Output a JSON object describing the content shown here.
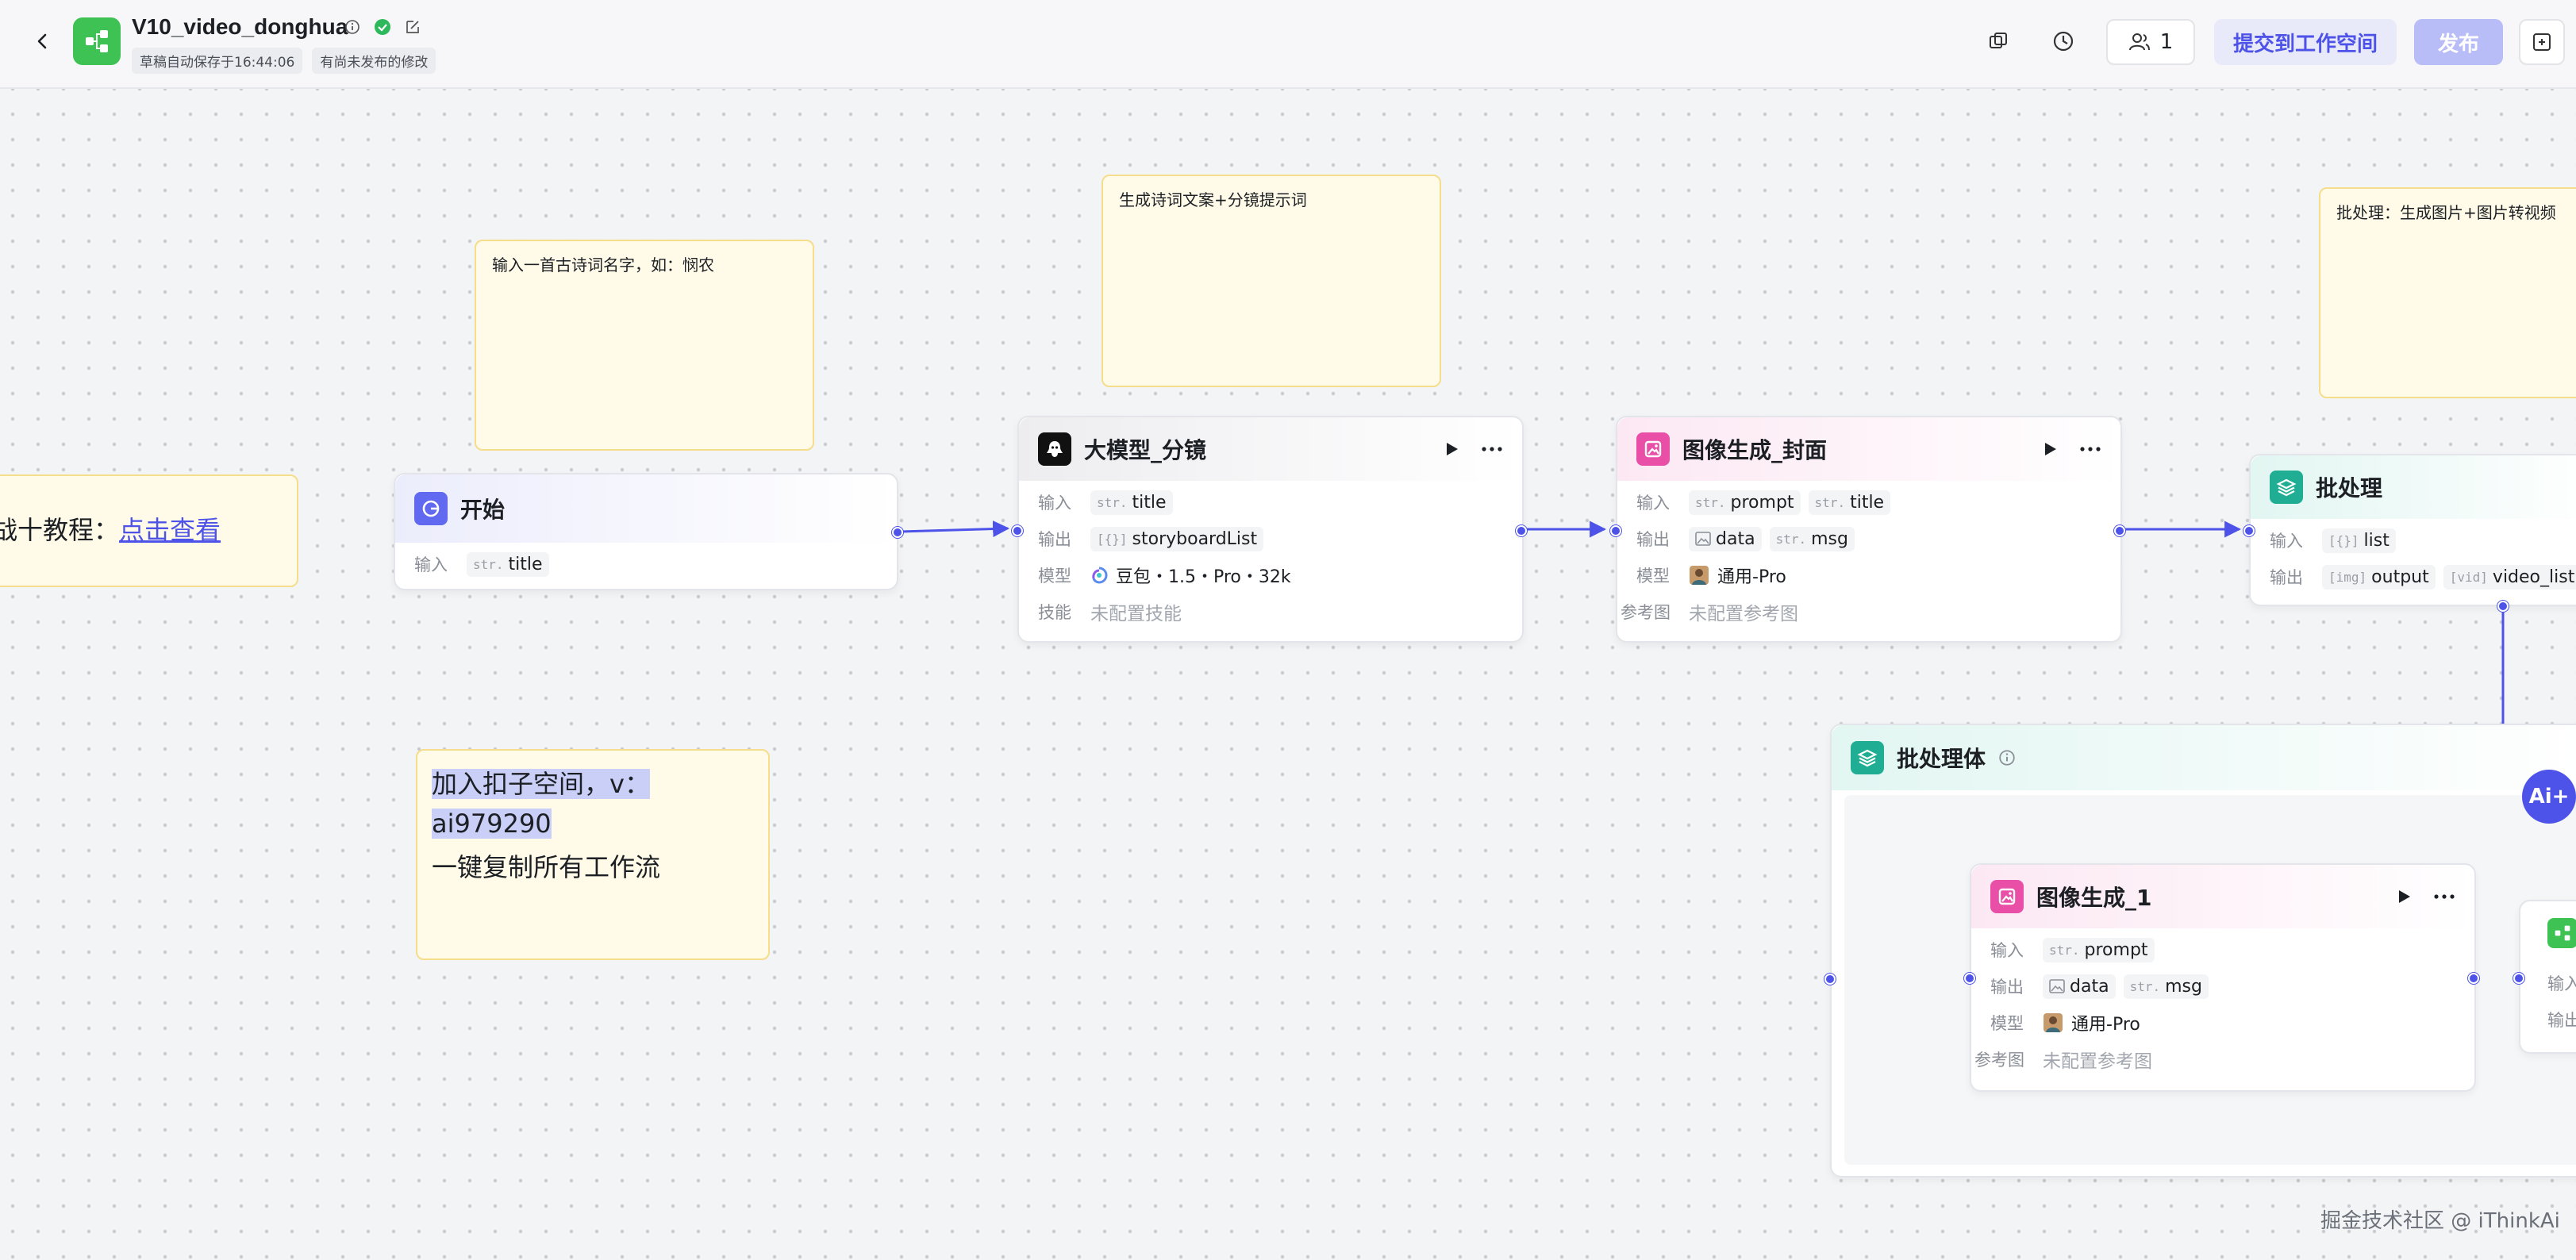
{
  "header": {
    "title": "V10_video_donghua",
    "autosave": "草稿自动保存于16:44:06",
    "unpublished": "有尚未发布的修改",
    "collaborators": "1",
    "submit_label": "提交到工作空间",
    "publish_label": "发布"
  },
  "notes": {
    "tutorial_prefix": "战十教程：",
    "tutorial_link": "点击查看",
    "input_hint": "输入一首古诗词名字，如：悯农",
    "gen_hint": "生成诗词文案+分镜提示词",
    "batch_hint": "批处理：生成图片+图片转视频",
    "join_line1": "加入扣子空间，v：",
    "join_line2": "ai979290",
    "join_line3": "一键复制所有工作流"
  },
  "nodes": {
    "start": {
      "title": "开始",
      "input_label": "输入",
      "input_type": "str.",
      "input_name": "title"
    },
    "llm": {
      "title": "大模型_分镜",
      "input_label": "输入",
      "input_type": "str.",
      "input_name": "title",
      "output_label": "输出",
      "output_type": "[{}]",
      "output_name": "storyboardList",
      "model_label": "模型",
      "model_value": "豆包・1.5・Pro・32k",
      "skill_label": "技能",
      "skill_value": "未配置技能"
    },
    "cover": {
      "title": "图像生成_封面",
      "input_label": "输入",
      "input1_type": "str.",
      "input1_name": "prompt",
      "input2_type": "str.",
      "input2_name": "title",
      "output_label": "输出",
      "output1_name": "data",
      "output2_type": "str.",
      "output2_name": "msg",
      "model_label": "模型",
      "model_value": "通用-Pro",
      "ref_label": "参考图",
      "ref_value": "未配置参考图"
    },
    "batch": {
      "title": "批处理",
      "input_label": "输入",
      "input_type": "[{}]",
      "input_name": "list",
      "output_label": "输出",
      "output1_type": "[img]",
      "output1_name": "output",
      "output2_type": "[vid]",
      "output2_name": "video_list"
    },
    "batch_body": {
      "title": "批处理体"
    },
    "image1": {
      "title": "图像生成_1",
      "input_label": "输入",
      "input_type": "str.",
      "input_name": "prompt",
      "output_label": "输出",
      "output1_name": "data",
      "output2_type": "str.",
      "output2_name": "msg",
      "model_label": "模型",
      "model_value": "通用-Pro",
      "ref_label": "参考图",
      "ref_value": "未配置参考图"
    },
    "partial": {
      "input_label": "输入",
      "output_label": "输出"
    }
  },
  "ai_button": "Ai+",
  "watermark": "掘金技术社区 @ iThinkAi",
  "colors": {
    "accent": "#4d53e8",
    "note_bg": "#fffbe8",
    "note_border": "#f5dd8b",
    "logo_green": "#3ec254"
  }
}
